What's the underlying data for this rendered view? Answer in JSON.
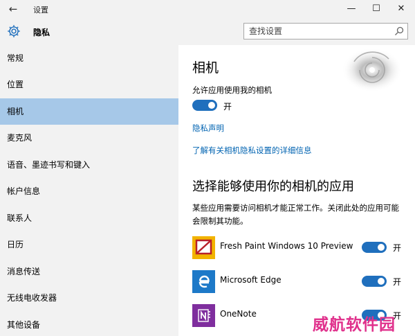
{
  "window": {
    "back_glyph": "←",
    "title": "设置",
    "minimize_glyph": "—",
    "maximize_glyph": "☐",
    "close_glyph": "✕"
  },
  "header": {
    "title": "隐私",
    "icon": "gear-icon",
    "search_placeholder": "查找设置",
    "search_icon": "search-icon"
  },
  "sidebar": {
    "items": [
      {
        "label": "常规",
        "active": false
      },
      {
        "label": "位置",
        "active": false
      },
      {
        "label": "相机",
        "active": true
      },
      {
        "label": "麦克风",
        "active": false
      },
      {
        "label": "语音、墨迹书写和键入",
        "active": false
      },
      {
        "label": "帐户信息",
        "active": false
      },
      {
        "label": "联系人",
        "active": false
      },
      {
        "label": "日历",
        "active": false
      },
      {
        "label": "消息传送",
        "active": false
      },
      {
        "label": "无线电收发器",
        "active": false
      },
      {
        "label": "其他设备",
        "active": false
      }
    ]
  },
  "main": {
    "heading": "相机",
    "allow_label": "允许应用使用我的相机",
    "allow_toggle": {
      "state": true,
      "label": "开"
    },
    "privacy_link": "隐私声明",
    "learn_more_link": "了解有关相机隐私设置的详细信息",
    "apps_heading": "选择能够使用你的相机的应用",
    "apps_description": "某些应用需要访问相机才能正常工作。关闭此处的应用可能会限制其功能。",
    "apps": [
      {
        "name": "Fresh Paint Windows 10 Preview",
        "icon": "fresh-paint-icon",
        "toggle": true,
        "label": "开"
      },
      {
        "name": "Microsoft Edge",
        "icon": "edge-icon",
        "toggle": true,
        "label": "开"
      },
      {
        "name": "OneNote",
        "icon": "onenote-icon",
        "toggle": true,
        "label": "开"
      }
    ]
  },
  "watermark": "威航软件园",
  "colors": {
    "accent": "#1f6fbd",
    "link": "#0063b1",
    "selected_nav": "#a6c8e8",
    "sidebar_bg": "#f2f2f2",
    "watermark": "#e0318c"
  }
}
